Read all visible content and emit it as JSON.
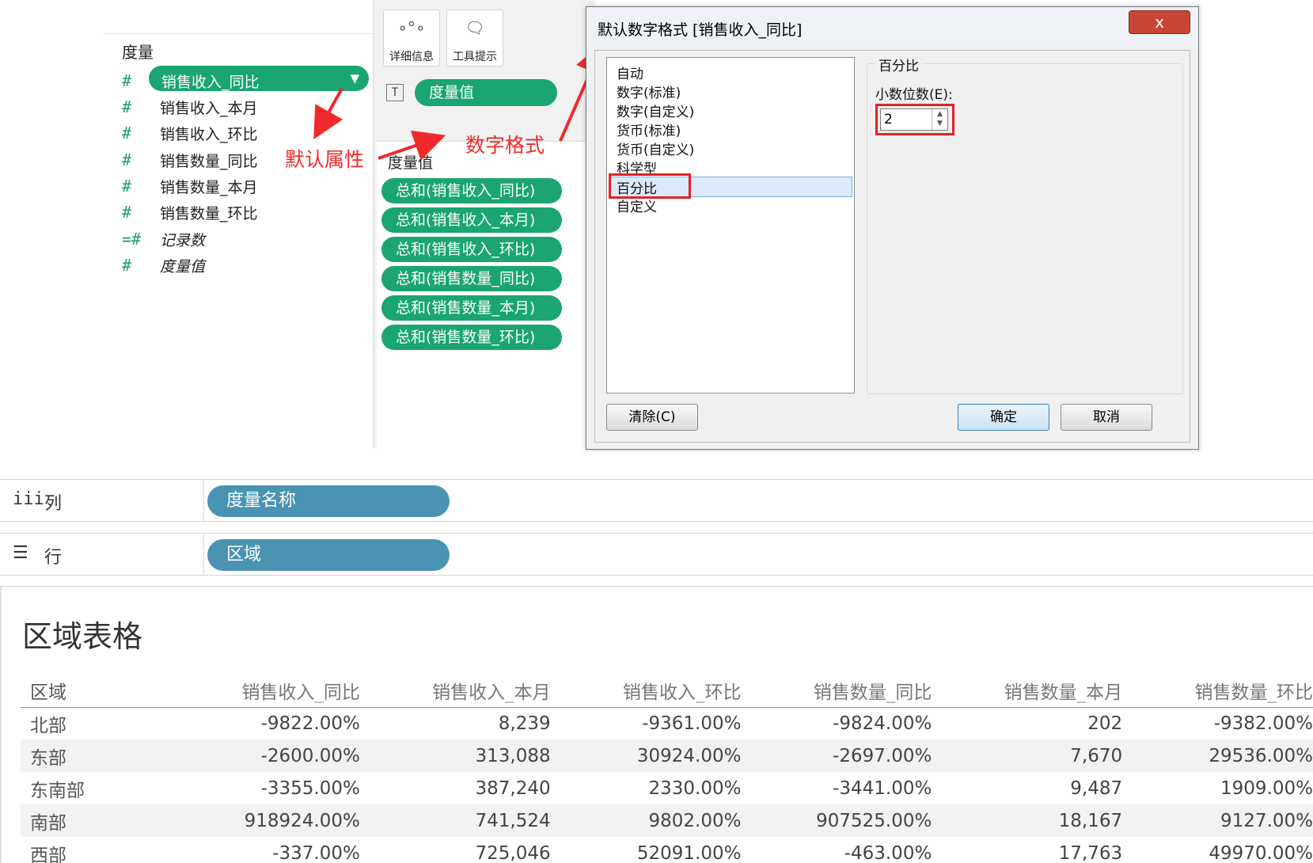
{
  "measures_panel": {
    "title": "度量",
    "fields": [
      {
        "icon": "#",
        "label": "销售收入_同比"
      },
      {
        "icon": "#",
        "label": "销售收入_本月"
      },
      {
        "icon": "#",
        "label": "销售收入_环比"
      },
      {
        "icon": "#",
        "label": "销售数量_同比"
      },
      {
        "icon": "#",
        "label": "销售数量_本月"
      },
      {
        "icon": "#",
        "label": "销售数量_环比"
      },
      {
        "icon": "=#",
        "label": "记录数"
      },
      {
        "icon": "#",
        "label": "度量值"
      }
    ]
  },
  "marks": {
    "detail_label": "详细信息",
    "tooltip_label": "工具提示",
    "text_pill": "度量值",
    "text_icon": "T"
  },
  "measure_values_card": {
    "title": "度量值",
    "pills": [
      "总和(销售收入_同比)",
      "总和(销售收入_本月)",
      "总和(销售收入_环比)",
      "总和(销售数量_同比)",
      "总和(销售数量_本月)",
      "总和(销售数量_环比)"
    ]
  },
  "annotations": {
    "default_props": "默认属性",
    "number_format": "数字格式",
    "color": "#f02a2a"
  },
  "dialog": {
    "title": "默认数字格式 [销售收入_同比]",
    "close": "x",
    "formats": [
      "自动",
      "数字(标准)",
      "数字(自定义)",
      "货币(标准)",
      "货币(自定义)",
      "科学型",
      "百分比",
      "自定义"
    ],
    "selected_format": "百分比",
    "group_label": "百分比",
    "decimal_label": "小数位数(E):",
    "decimal_value": "2",
    "clear_button": "清除(C)",
    "ok_button": "确定",
    "cancel_button": "取消"
  },
  "shelves": {
    "columns": {
      "label": "列",
      "icon": "iii",
      "pill": "度量名称"
    },
    "rows": {
      "label": "行",
      "icon": "☰",
      "pill": "区域"
    }
  },
  "view": {
    "title": "区域表格",
    "columns": [
      "区域",
      "销售收入_同比",
      "销售收入_本月",
      "销售收入_环比",
      "销售数量_同比",
      "销售数量_本月",
      "销售数量_环比"
    ],
    "rows": [
      [
        "北部",
        "-9822.00%",
        "8,239",
        "-9361.00%",
        "-9824.00%",
        "202",
        "-9382.00%"
      ],
      [
        "东部",
        "-2600.00%",
        "313,088",
        "30924.00%",
        "-2697.00%",
        "7,670",
        "29536.00%"
      ],
      [
        "东南部",
        "-3355.00%",
        "387,240",
        "2330.00%",
        "-3441.00%",
        "9,487",
        "1909.00%"
      ],
      [
        "南部",
        "918924.00%",
        "741,524",
        "9802.00%",
        "907525.00%",
        "18,167",
        "9127.00%"
      ],
      [
        "西部",
        "-337.00%",
        "725,046",
        "52091.00%",
        "-463.00%",
        "17,763",
        "49970.00%"
      ]
    ]
  },
  "colors": {
    "green_pill": "#1aa572",
    "blue_pill": "#4a93b3",
    "annotation_red": "#f02a2a"
  }
}
